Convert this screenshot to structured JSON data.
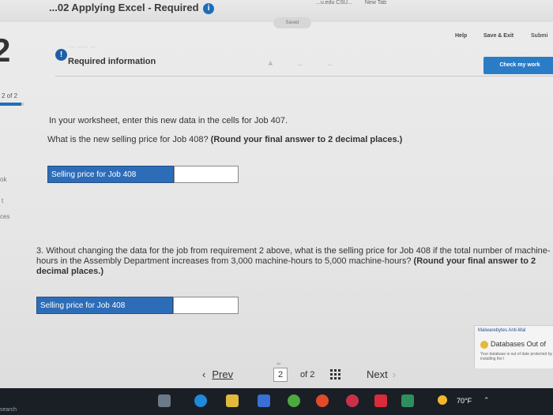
{
  "browser": {
    "tab_fragment": "...u.edu CSU...",
    "new_tab": "New Tab"
  },
  "assignment": {
    "title": "...02 Applying Excel - Required",
    "info_icon": "i",
    "saved_label": "Saved"
  },
  "header_actions": {
    "help": "Help",
    "save_exit": "Save & Exit",
    "submit": "Submi",
    "check_work": "Check my work"
  },
  "progress": {
    "page_badge": "2",
    "label": "2 of 2",
    "fraction": 0.9,
    "accent": "#1e6fb8"
  },
  "sidebar_fragments": [
    "ok",
    "t",
    "ces"
  ],
  "required_info": {
    "alert_icon": "!",
    "sublabel": "... ...... ...",
    "label": "Required information",
    "column_marks": [
      "A",
      "...",
      "..."
    ]
  },
  "question2": {
    "instruction": "In your worksheet, enter this new data in the cells for Job 407.",
    "question": "What is the new selling price for Job 408?",
    "hint": "(Round your final answer to 2 decimal places.)",
    "answer_label": "Selling price for Job 408",
    "answer_value": ""
  },
  "question3": {
    "text": "3. Without changing the data for the job from requirement 2 above, what is the selling price for Job 408 if the total number of machine-hours in the Assembly Department increases from 3,000 machine-hours to 5,000 machine-hours?",
    "hint": "(Round your final answer to 2 decimal places.)",
    "answer_label": "Selling price for Job 408",
    "answer_value": ""
  },
  "pagination": {
    "prev": "Prev",
    "current": "2",
    "of_label": "of 2",
    "next": "Next"
  },
  "notification": {
    "brand": "Malwarebytes Anti-Mal",
    "title": "Databases Out of",
    "body": "Your database is out of date protected by installing the l"
  },
  "taskbar": {
    "temperature": "70°F",
    "search_fragment": "search"
  },
  "colors": {
    "accent_blue": "#2d6db8",
    "button_blue": "#2a7cc7",
    "taskbar": "#1a1f26"
  }
}
